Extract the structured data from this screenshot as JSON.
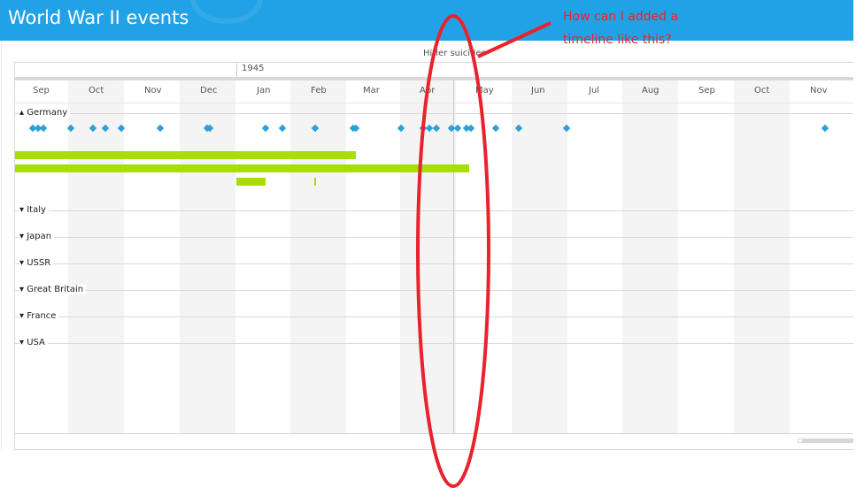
{
  "header": {
    "title": "World War II events",
    "color": "#22A2E6"
  },
  "timeline": {
    "year_label": "1945",
    "months": [
      "Sep",
      "Oct",
      "Nov",
      "Dec",
      "Jan",
      "Feb",
      "Mar",
      "Apr",
      "May",
      "Jun",
      "Jul",
      "Aug",
      "Sep",
      "Oct",
      "Nov"
    ],
    "marker_label": "Hitler suicides",
    "groups": [
      "Germany",
      "Italy",
      "Japan",
      "USSR",
      "Great Britain",
      "France",
      "USA"
    ],
    "event_color": "#2E9FD7",
    "range_color": "#A8DD08"
  },
  "annotation": {
    "line1": "How can I added a",
    "line2": "timeline like this?",
    "color": "#E8232D"
  }
}
